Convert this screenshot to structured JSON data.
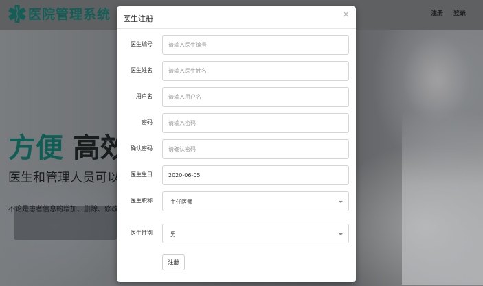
{
  "background": {
    "logo_icon": "medical-star-icon",
    "logo_text": "医院管理系统",
    "nav": {
      "register": "注册",
      "login": "登录"
    },
    "hero": {
      "title_part1": "方便",
      "title_part2": "高效",
      "subtitle": "医生和管理人员可以",
      "description": "不论是患者信息的增加、删除、修改还"
    }
  },
  "modal": {
    "title": "医生注册",
    "close_symbol": "×",
    "fields": {
      "doctor_id": {
        "label": "医生编号",
        "placeholder": "请输入医生编号",
        "value": ""
      },
      "doctor_name": {
        "label": "医生姓名",
        "placeholder": "请输入医生姓名",
        "value": ""
      },
      "username": {
        "label": "用户名",
        "placeholder": "请输入用户名",
        "value": ""
      },
      "password": {
        "label": "密码",
        "placeholder": "请输入密码",
        "value": ""
      },
      "confirm_password": {
        "label": "确认密码",
        "placeholder": "请确认密码",
        "value": ""
      },
      "birthday": {
        "label": "医生生日",
        "value": "2020-06-05"
      },
      "title": {
        "label": "医生职称",
        "selected": "主任医师"
      },
      "gender": {
        "label": "医生性别",
        "selected": "男"
      }
    },
    "submit_label": "注册"
  },
  "colors": {
    "brand": "#155e57",
    "overlay": "#5f6061",
    "modal_bg": "#ffffff"
  }
}
